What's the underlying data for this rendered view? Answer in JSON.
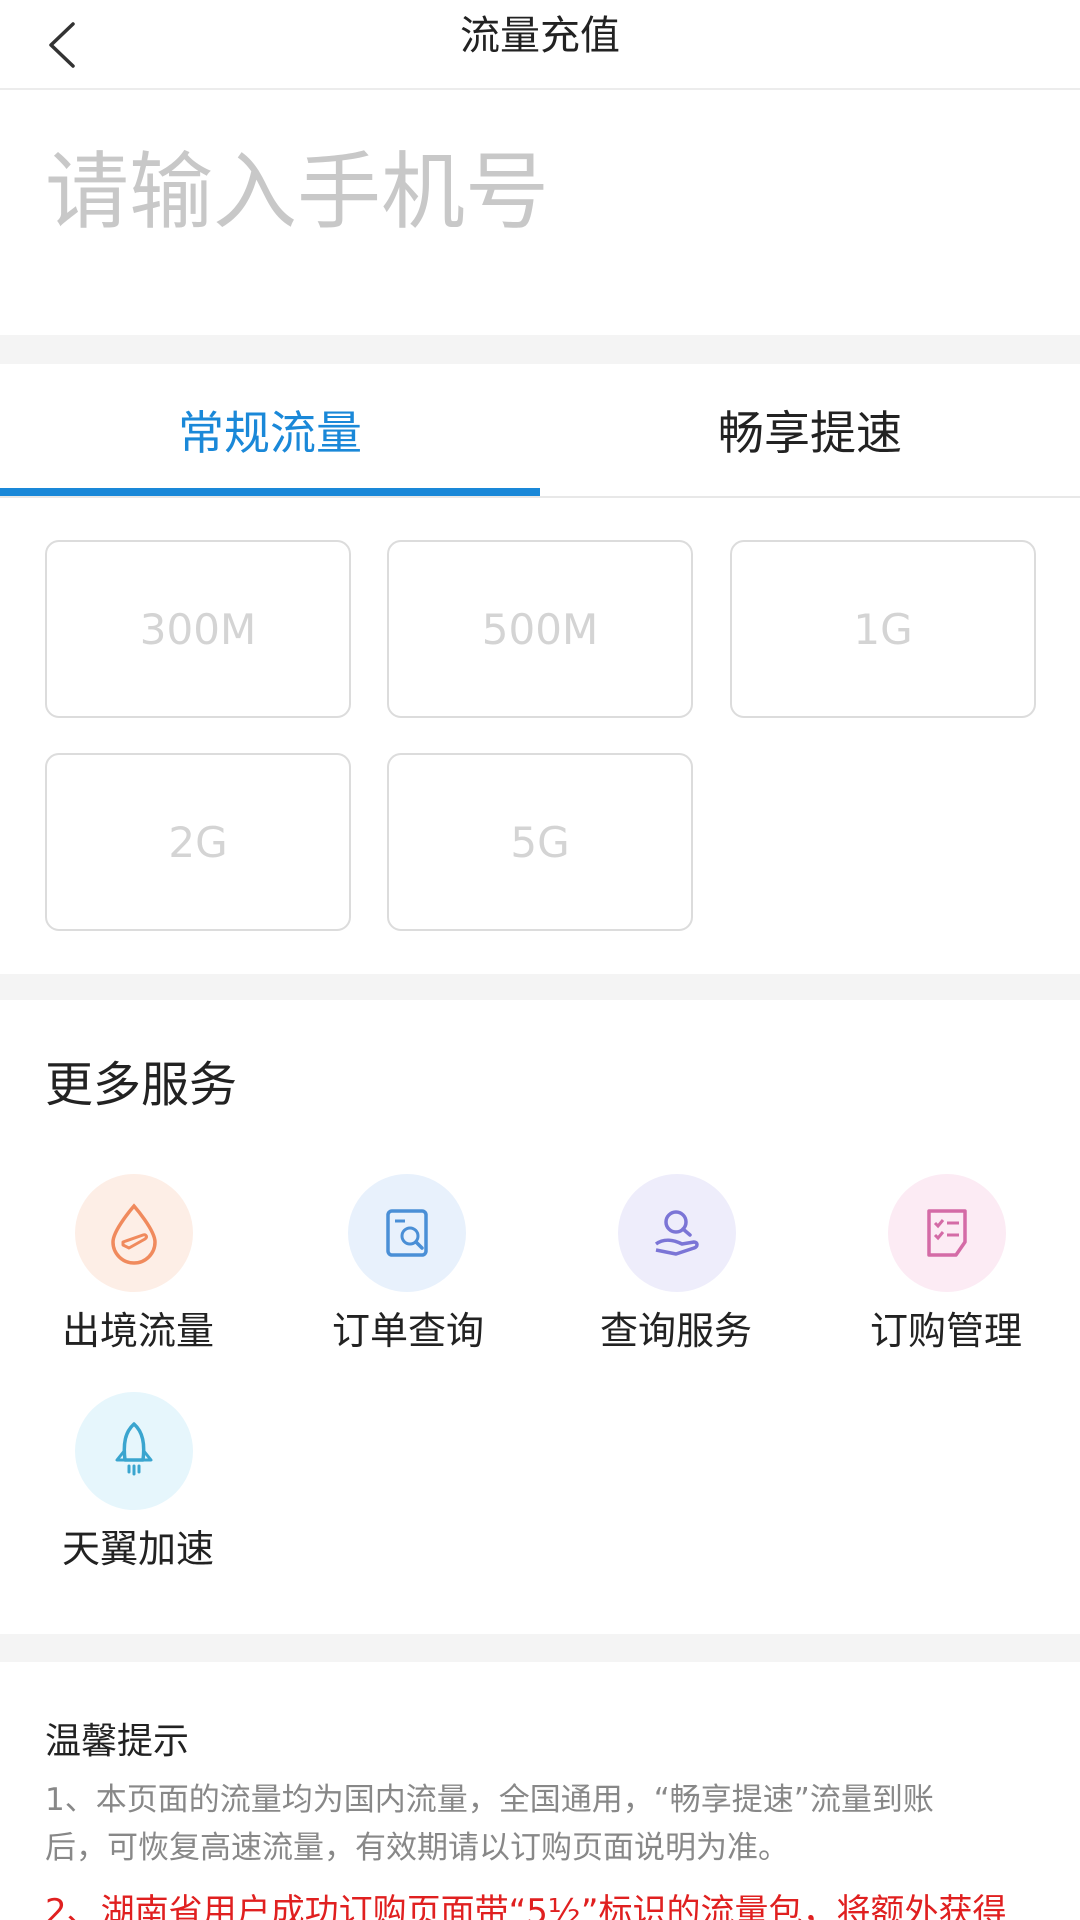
{
  "header": {
    "title": "流量充值",
    "back_icon": "chevron-left-icon"
  },
  "phone": {
    "placeholder": "请输入手机号"
  },
  "tabs": [
    {
      "label": "常规流量",
      "active": true
    },
    {
      "label": "畅享提速",
      "active": false
    }
  ],
  "accent_color": "#1a88d8",
  "packages": [
    {
      "label": "300M"
    },
    {
      "label": "500M"
    },
    {
      "label": "1G"
    },
    {
      "label": "2G"
    },
    {
      "label": "5G"
    }
  ],
  "services": {
    "title": "更多服务",
    "items": [
      {
        "label": "出境流量",
        "icon": "droplet-plane-icon",
        "color": "#f08a5d"
      },
      {
        "label": "订单查询",
        "icon": "order-search-icon",
        "color": "#4a8fd6"
      },
      {
        "label": "查询服务",
        "icon": "search-service-icon",
        "color": "#7b75d6"
      },
      {
        "label": "订购管理",
        "icon": "checklist-icon",
        "color": "#d46ba6"
      },
      {
        "label": "天翼加速",
        "icon": "rocket-icon",
        "color": "#3aa5cf"
      }
    ]
  },
  "tips": {
    "title": "温馨提示",
    "line1a": "1、本页面的流量均为国内流量，全国通用，“畅享提速”流量到账",
    "line1b": "后，可恢复高速流量，有效期请以订购页面说明为准。",
    "line2": "2、湖南省用户成功订购页面带“5½”标识的流量包，将额外获得"
  },
  "tips_colors": {
    "text": "#888888",
    "highlight": "#e02020"
  }
}
